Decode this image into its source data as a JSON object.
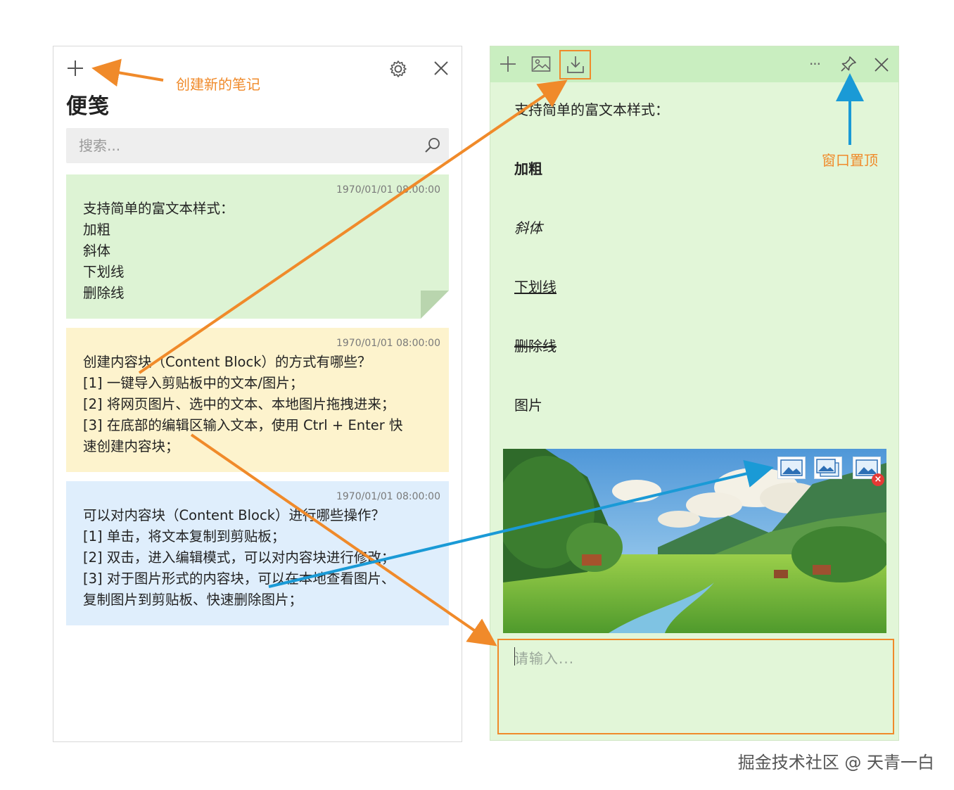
{
  "left_window": {
    "title": "便笺",
    "search_placeholder": "搜索...",
    "notes": [
      {
        "timestamp": "1970/01/01 08:00:00",
        "lines": [
          "支持简单的富文本样式：",
          "加粗",
          "斜体",
          "下划线",
          "删除线"
        ]
      },
      {
        "timestamp": "1970/01/01 08:00:00",
        "lines": [
          "创建内容块（Content Block）的方式有哪些？",
          "[1] 一键导入剪贴板中的文本/图片；",
          "[2] 将网页图片、选中的文本、本地图片拖拽进来；",
          "[3] 在底部的编辑区输入文本，使用 Ctrl + Enter 快",
          "速创建内容块；"
        ]
      },
      {
        "timestamp": "1970/01/01 08:00:00",
        "lines": [
          "可以对内容块（Content Block）进行哪些操作？",
          "[1] 单击，将文本复制到剪贴板；",
          "[2] 双击，进入编辑模式，可以对内容块进行修改；",
          "[3] 对于图片形式的内容块，可以在本地查看图片、",
          "复制图片到剪贴板、快速删除图片；"
        ]
      }
    ],
    "icons": [
      "plus-icon",
      "gear-icon",
      "close-icon",
      "search-icon"
    ]
  },
  "right_window": {
    "toolbar_icons": [
      "plus-icon",
      "image-icon",
      "download-icon",
      "more-icon",
      "pin-icon",
      "close-icon"
    ],
    "more_label": "···",
    "content": {
      "heading": "支持简单的富文本样式：",
      "bold": "加粗",
      "italic": "斜体",
      "underline": "下划线",
      "strikethrough": "删除线",
      "image_label": "图片"
    },
    "editor_placeholder": "请输入...",
    "delete_badge": "×"
  },
  "annotations": {
    "create_note": "创建新的笔记",
    "pin_window": "窗口置顶"
  },
  "watermark": "掘金技术社区 @ 天青一白",
  "colors": {
    "orange_accent": "#f08a2a",
    "blue_arrow": "#1a9ad6",
    "green_note": "#ddf3d4",
    "yellow_note": "#fdf3cd",
    "blue_note": "#dfeefc",
    "right_bg": "#e2f6d8",
    "right_toolbar": "#c9eec0"
  }
}
